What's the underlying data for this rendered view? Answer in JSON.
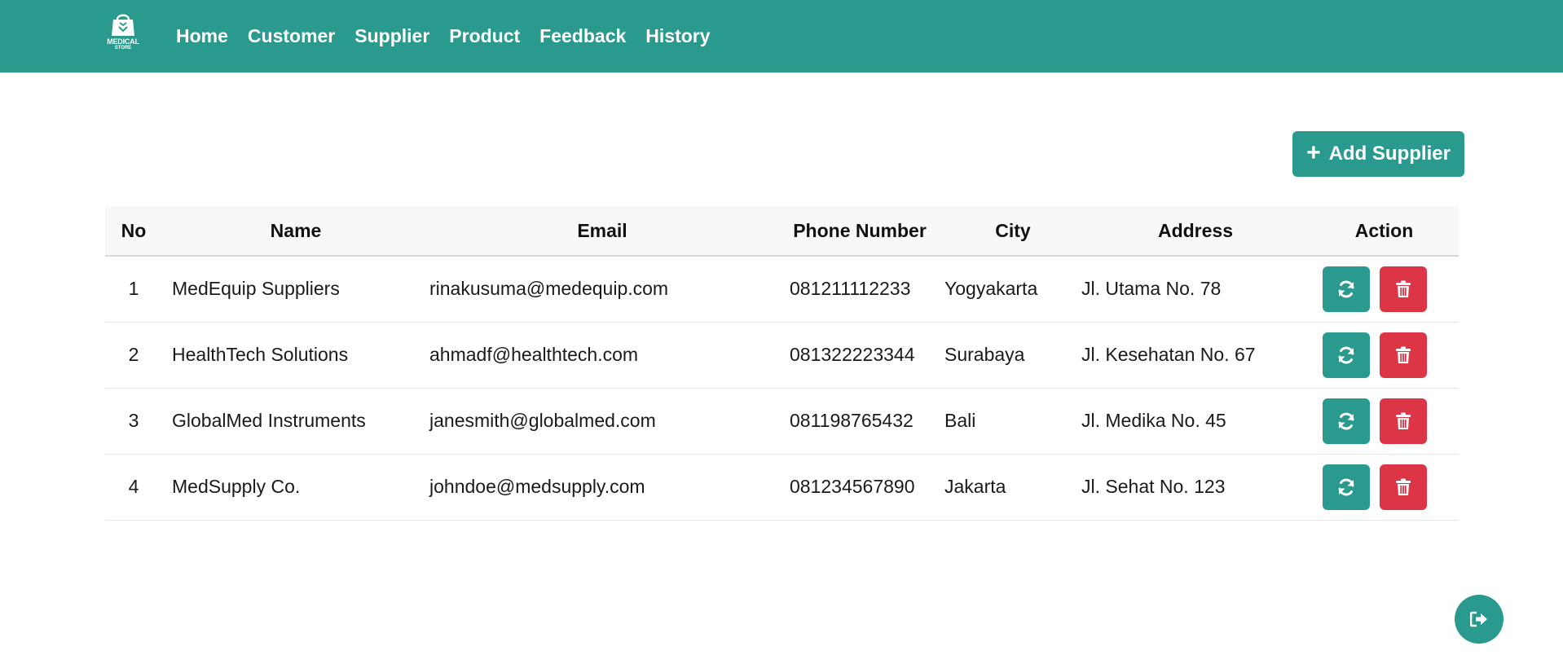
{
  "brand": {
    "line1": "MEDICAL",
    "line2": "STORE",
    "icon": "shopping-bag-icon"
  },
  "nav": {
    "items": [
      {
        "label": "Home"
      },
      {
        "label": "Customer"
      },
      {
        "label": "Supplier"
      },
      {
        "label": "Product"
      },
      {
        "label": "Feedback"
      },
      {
        "label": "History"
      }
    ]
  },
  "toolbar": {
    "add_label": "Add Supplier",
    "add_icon": "plus-icon"
  },
  "table": {
    "headers": {
      "no": "No",
      "name": "Name",
      "email": "Email",
      "phone": "Phone Number",
      "city": "City",
      "address": "Address",
      "action": "Action"
    },
    "rows": [
      {
        "no": "1",
        "name": "MedEquip Suppliers",
        "email": "rinakusuma@medequip.com",
        "phone": "081211112233",
        "city": "Yogyakarta",
        "address": "Jl. Utama No. 78"
      },
      {
        "no": "2",
        "name": "HealthTech Solutions",
        "email": "ahmadf@healthtech.com",
        "phone": "081322223344",
        "city": "Surabaya",
        "address": "Jl. Kesehatan No. 67"
      },
      {
        "no": "3",
        "name": "GlobalMed Instruments",
        "email": "janesmith@globalmed.com",
        "phone": "081198765432",
        "city": "Bali",
        "address": "Jl. Medika No. 45"
      },
      {
        "no": "4",
        "name": "MedSupply Co.",
        "email": "johndoe@medsupply.com",
        "phone": "081234567890",
        "city": "Jakarta",
        "address": "Jl. Sehat No. 123"
      }
    ],
    "action_icons": {
      "update": "refresh-icon",
      "delete": "trash-icon"
    }
  },
  "logout": {
    "icon": "logout-icon"
  },
  "colors": {
    "primary": "#2a9a8e",
    "danger": "#dc3545",
    "header_bg": "#f7f8f9"
  }
}
